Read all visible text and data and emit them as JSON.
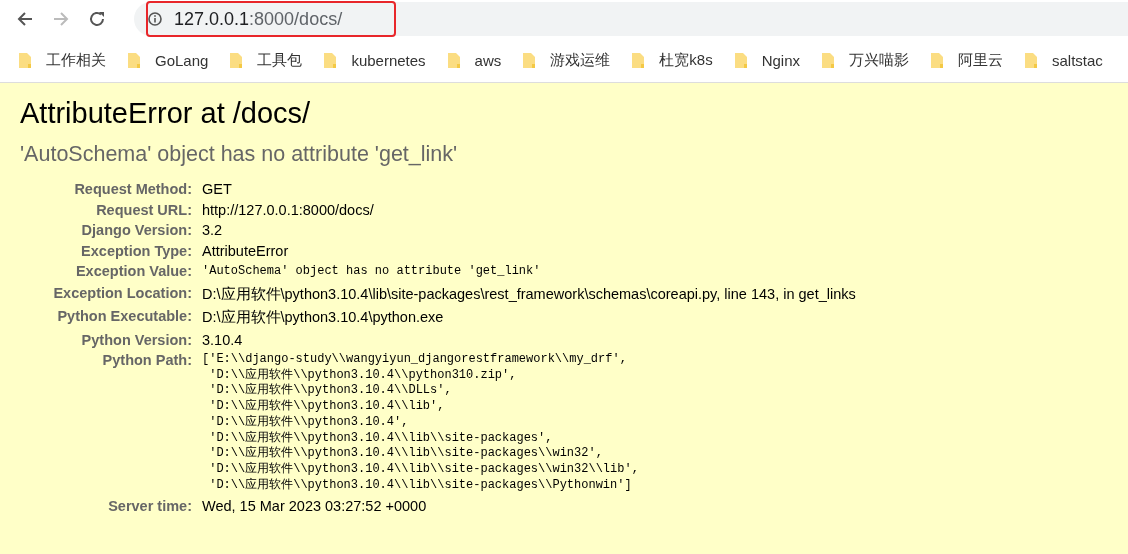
{
  "browser": {
    "address": {
      "host": "127.0.0.1",
      "path": ":8000/docs/"
    },
    "bookmarks": [
      "工作相关",
      "GoLang",
      "工具包",
      "kubernetes",
      "aws",
      "游戏运维",
      "杜宽k8s",
      "Nginx",
      "万兴喵影",
      "阿里云",
      "saltstac"
    ]
  },
  "error": {
    "title": "AttributeError at /docs/",
    "message": "'AutoSchema' object has no attribute 'get_link'",
    "rows": [
      {
        "label": "Request Method:",
        "kind": "text",
        "value": "GET"
      },
      {
        "label": "Request URL:",
        "kind": "text",
        "value": "http://127.0.0.1:8000/docs/"
      },
      {
        "label": "Django Version:",
        "kind": "text",
        "value": "3.2"
      },
      {
        "label": "Exception Type:",
        "kind": "text",
        "value": "AttributeError"
      },
      {
        "label": "Exception Value:",
        "kind": "mono",
        "value": "'AutoSchema' object has no attribute 'get_link'"
      },
      {
        "label": "Exception Location:",
        "kind": "text",
        "value": "D:\\应用软件\\python3.10.4\\lib\\site-packages\\rest_framework\\schemas\\coreapi.py, line 143, in get_links"
      },
      {
        "label": "Python Executable:",
        "kind": "text",
        "value": "D:\\应用软件\\python3.10.4\\python.exe"
      },
      {
        "label": "Python Version:",
        "kind": "text",
        "value": "3.10.4"
      },
      {
        "label": "Python Path:",
        "kind": "list",
        "lines": [
          "['E:\\\\django-study\\\\wangyiyun_djangorestframework\\\\my_drf',",
          " 'D:\\\\应用软件\\\\python3.10.4\\\\python310.zip',",
          " 'D:\\\\应用软件\\\\python3.10.4\\\\DLLs',",
          " 'D:\\\\应用软件\\\\python3.10.4\\\\lib',",
          " 'D:\\\\应用软件\\\\python3.10.4',",
          " 'D:\\\\应用软件\\\\python3.10.4\\\\lib\\\\site-packages',",
          " 'D:\\\\应用软件\\\\python3.10.4\\\\lib\\\\site-packages\\\\win32',",
          " 'D:\\\\应用软件\\\\python3.10.4\\\\lib\\\\site-packages\\\\win32\\\\lib',",
          " 'D:\\\\应用软件\\\\python3.10.4\\\\lib\\\\site-packages\\\\Pythonwin']"
        ]
      },
      {
        "label": "Server time:",
        "kind": "text",
        "value": "Wed, 15 Mar 2023 03:27:52 +0000"
      }
    ]
  }
}
